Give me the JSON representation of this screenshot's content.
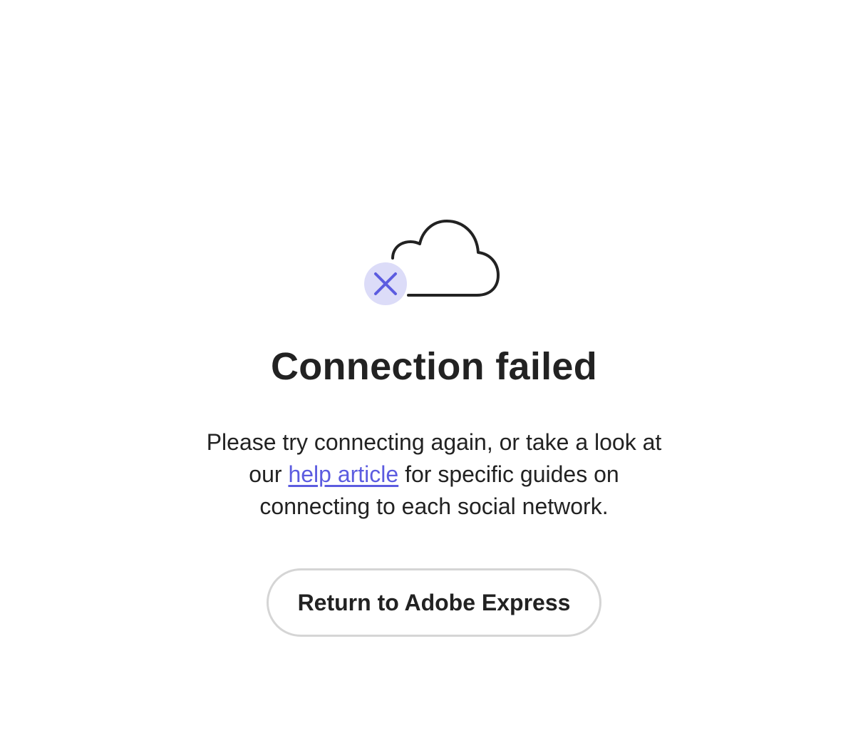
{
  "illustration": {
    "cloud_icon": "cloud-icon",
    "error_icon": "close-icon",
    "colors": {
      "cloud_stroke": "#222222",
      "badge_fill": "#dcdcf8",
      "badge_x": "#5c5ce0"
    }
  },
  "title": "Connection failed",
  "message": {
    "before_link": "Please try connecting again, or take a look at our ",
    "link_text": "help article",
    "after_link": " for specific guides on connecting to each social network."
  },
  "return_button": {
    "label": "Return to Adobe Express"
  },
  "colors": {
    "link": "#5c5ce0",
    "text": "#222222",
    "button_border": "#d5d5d5"
  }
}
